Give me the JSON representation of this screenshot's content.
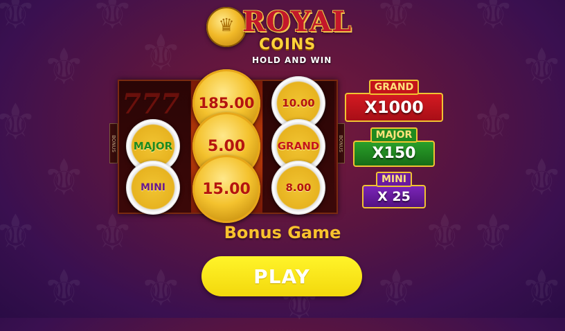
{
  "logo": {
    "title": "ROYAL",
    "subtitle": "COINS",
    "tagline": "HOLD AND WIN"
  },
  "reels": {
    "side_label": "BONUS",
    "ghost_symbol": "777",
    "coins": [
      {
        "name": "coin-major",
        "text": "MAJOR",
        "type": "silver",
        "color": "#1f8a1f"
      },
      {
        "name": "coin-mini",
        "text": "MINI",
        "type": "silver",
        "color": "#6a1a8a"
      },
      {
        "name": "coin-185",
        "text": "185.00",
        "type": "gold",
        "color": "#b4140f"
      },
      {
        "name": "coin-5",
        "text": "5.00",
        "type": "gold",
        "color": "#b4140f"
      },
      {
        "name": "coin-15",
        "text": "15.00",
        "type": "gold",
        "color": "#b4140f"
      },
      {
        "name": "coin-10",
        "text": "10.00",
        "type": "silver",
        "color": "#b4140f"
      },
      {
        "name": "coin-grand",
        "text": "GRAND",
        "type": "silver",
        "color": "#c4141a"
      },
      {
        "name": "coin-8",
        "text": "8.00",
        "type": "silver",
        "color": "#b4140f"
      }
    ]
  },
  "jackpots": {
    "grand": {
      "label": "GRAND",
      "value": "X1000",
      "color": "#c4141a"
    },
    "major": {
      "label": "MAJOR",
      "value": "X150",
      "color": "#1f8a1f"
    },
    "mini": {
      "label": "MINI",
      "value": "X 25",
      "color": "#6a1aa0"
    }
  },
  "bonus_title": "Bonus Game",
  "play_label": "PLAY"
}
